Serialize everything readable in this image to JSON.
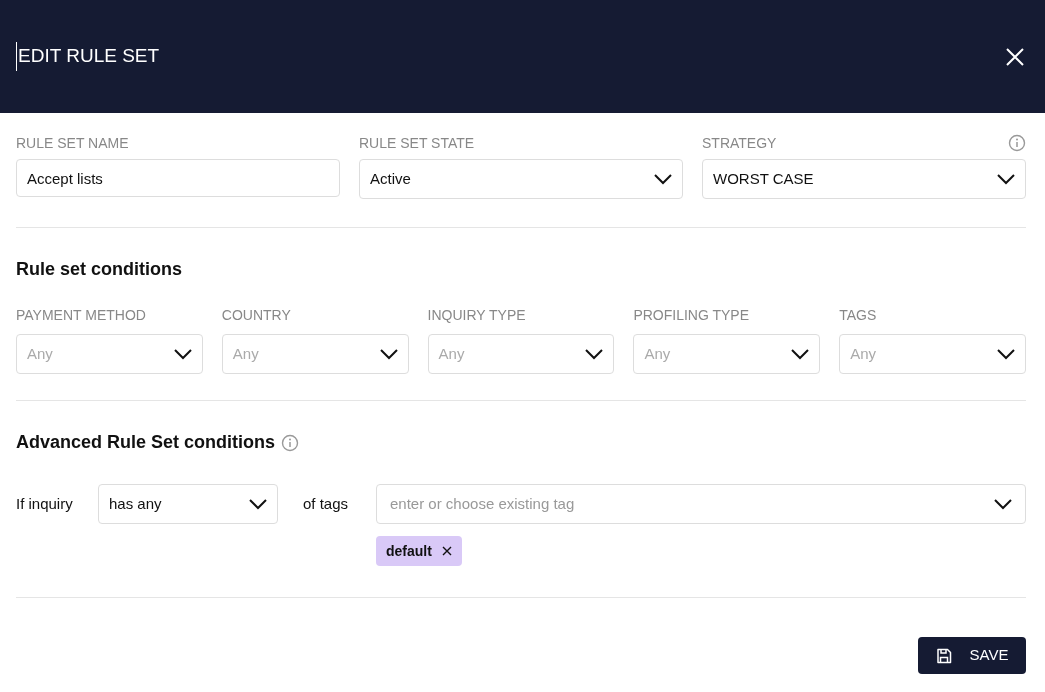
{
  "header": {
    "title": "EDIT RULE SET"
  },
  "fields": [
    {
      "kind": "text",
      "label": "RULE SET NAME",
      "value": "Accept lists"
    },
    {
      "kind": "select",
      "label": "RULE SET STATE",
      "value": "Active"
    },
    {
      "kind": "select",
      "label": "STRATEGY",
      "value": "WORST CASE",
      "info": true
    }
  ],
  "conditions": {
    "title": "Rule set conditions",
    "filters": [
      {
        "label": "PAYMENT METHOD",
        "placeholder": "Any"
      },
      {
        "label": "COUNTRY",
        "placeholder": "Any"
      },
      {
        "label": "INQUIRY TYPE",
        "placeholder": "Any"
      },
      {
        "label": "PROFILING TYPE",
        "placeholder": "Any"
      },
      {
        "label": "TAGS",
        "placeholder": "Any"
      }
    ]
  },
  "advanced": {
    "title": "Advanced Rule Set conditions",
    "prefix": "If inquiry",
    "operator": "has any",
    "middle": "of tags",
    "tag_placeholder": "enter or choose existing tag",
    "tags": [
      "default"
    ]
  },
  "save_button": "SAVE"
}
